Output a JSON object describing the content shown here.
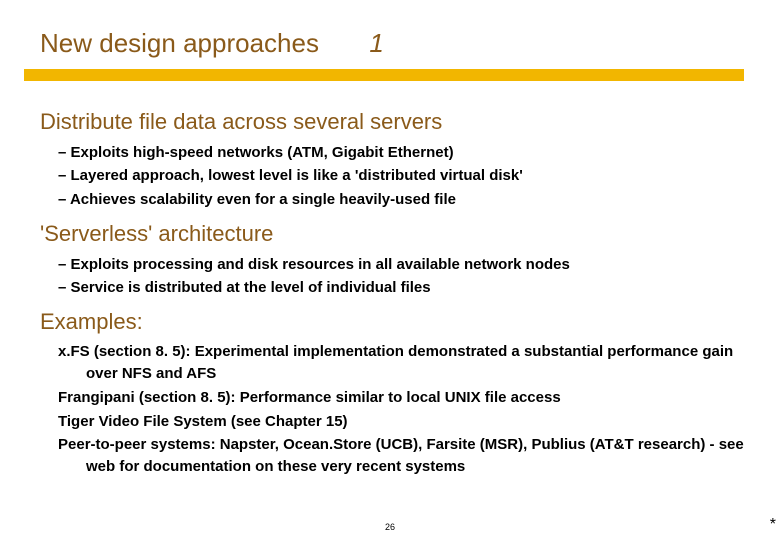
{
  "title": {
    "main": "New design approaches",
    "num": "1"
  },
  "sections": [
    {
      "heading": "Distribute file data across several servers",
      "bullets": [
        "Exploits high-speed networks (ATM, Gigabit Ethernet)",
        "Layered approach, lowest level is like a 'distributed virtual disk'",
        "Achieves scalability even for a single heavily-used file"
      ]
    },
    {
      "heading": "'Serverless' architecture",
      "bullets": [
        "Exploits processing and disk resources in all available network nodes",
        "Service is distributed at the level of individual files"
      ]
    }
  ],
  "examples_heading": "Examples:",
  "examples": [
    "x.FS (section 8. 5): Experimental implementation demonstrated a substantial performance gain over NFS and AFS",
    "Frangipani (section 8. 5): Performance similar to local UNIX file access",
    "Tiger Video File System (see Chapter 15)",
    "Peer-to-peer systems: Napster, Ocean.Store (UCB), Farsite (MSR), Publius (AT&T research) - see web for documentation on these very recent systems"
  ],
  "page_number": "26",
  "asterisk": "*"
}
